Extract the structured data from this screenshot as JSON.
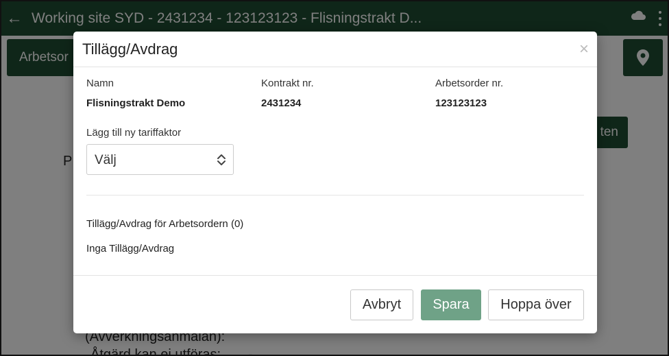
{
  "topbar": {
    "title": "Working site SYD - 2431234 - 123123123 - Flisningstrakt D..."
  },
  "page": {
    "arbetsorder_button": "Arbetsor",
    "ten_button": "ten",
    "p_text": "P",
    "line1": "(Avverkningsanmälan):",
    "line2": "Åtgärd kan ej utföras:",
    "dash": "-"
  },
  "modal": {
    "title": "Tillägg/Avdrag",
    "close": "×",
    "fields": [
      {
        "label": "Namn",
        "value": "Flisningstrakt Demo"
      },
      {
        "label": "Kontrakt nr.",
        "value": "2431234"
      },
      {
        "label": "Arbetsorder nr.",
        "value": "123123123"
      }
    ],
    "add_label": "Lägg till ny tariffaktor",
    "select_value": "Välj",
    "list_heading": "Tillägg/Avdrag för Arbetsordern (0)",
    "list_empty": "Inga Tillägg/Avdrag",
    "buttons": {
      "cancel": "Avbryt",
      "save": "Spara",
      "skip": "Hoppa över"
    }
  },
  "colors": {
    "topbar": "#1f4d33",
    "save_button": "#6fa287"
  }
}
